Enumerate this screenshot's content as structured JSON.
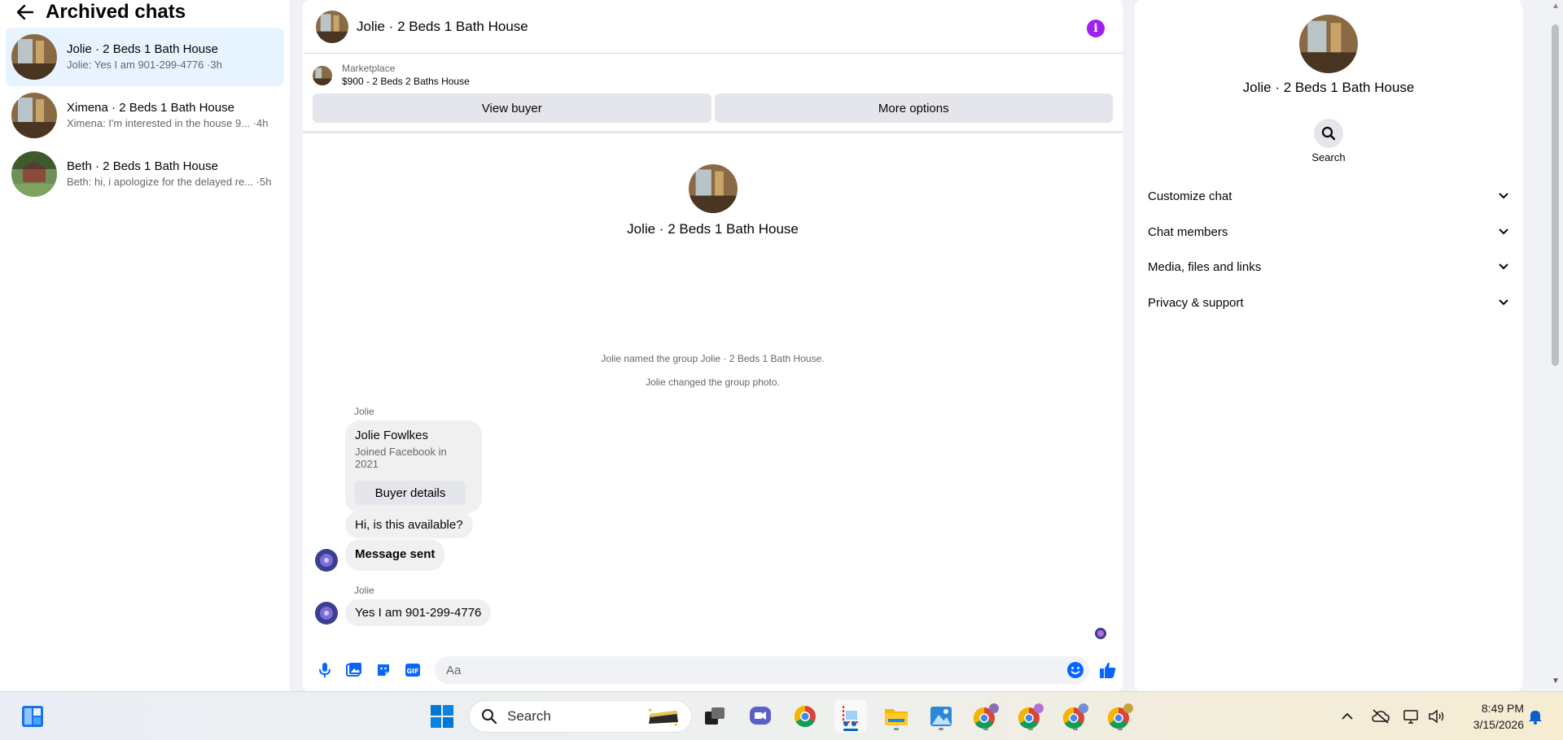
{
  "sidebar": {
    "title": "Archived chats",
    "chats": [
      {
        "name": "Jolie · 2 Beds 1 Bath House",
        "preview": "Jolie: Yes I am 901-299-4776 ·3h"
      },
      {
        "name": "Ximena · 2 Beds 1 Bath House",
        "preview": "Ximena: I'm interested in the house 9... ·4h"
      },
      {
        "name": "Beth · 2 Beds 1 Bath House",
        "preview": "Beth: hi, i apologize for the delayed re... ·5h"
      }
    ]
  },
  "conversation": {
    "title": "Jolie · 2 Beds 1 Bath House",
    "marketplace_label": "Marketplace",
    "listing": "$900 - 2 Beds 2 Baths House",
    "view_buyer_label": "View buyer",
    "more_options_label": "More options",
    "intro_name": "Jolie · 2 Beds 1 Bath House",
    "system_messages": [
      "Jolie named the group Jolie · 2 Beds 1 Bath House.",
      "Jolie changed the group photo."
    ],
    "sender_1": "Jolie",
    "card": {
      "name": "Jolie Fowlkes",
      "subtitle": "Joined Facebook in 2021",
      "button": "Buyer details"
    },
    "msg_available": "Hi, is this available?",
    "msg_sent": "Message sent",
    "sender_2": "Jolie",
    "msg_reply": "Yes I am 901-299-4776",
    "composer_placeholder": "Aa"
  },
  "details": {
    "name": "Jolie · 2 Beds 1 Bath House",
    "search_label": "Search",
    "sections": [
      "Customize chat",
      "Chat members",
      "Media, files and links",
      "Privacy & support"
    ]
  },
  "taskbar": {
    "search_label": "Search",
    "time": "8:49 PM",
    "date": "3/15/2026"
  },
  "colors": {
    "accent": "#0866ff",
    "info": "#a020f0",
    "active_chat": "#e7f3ff"
  }
}
